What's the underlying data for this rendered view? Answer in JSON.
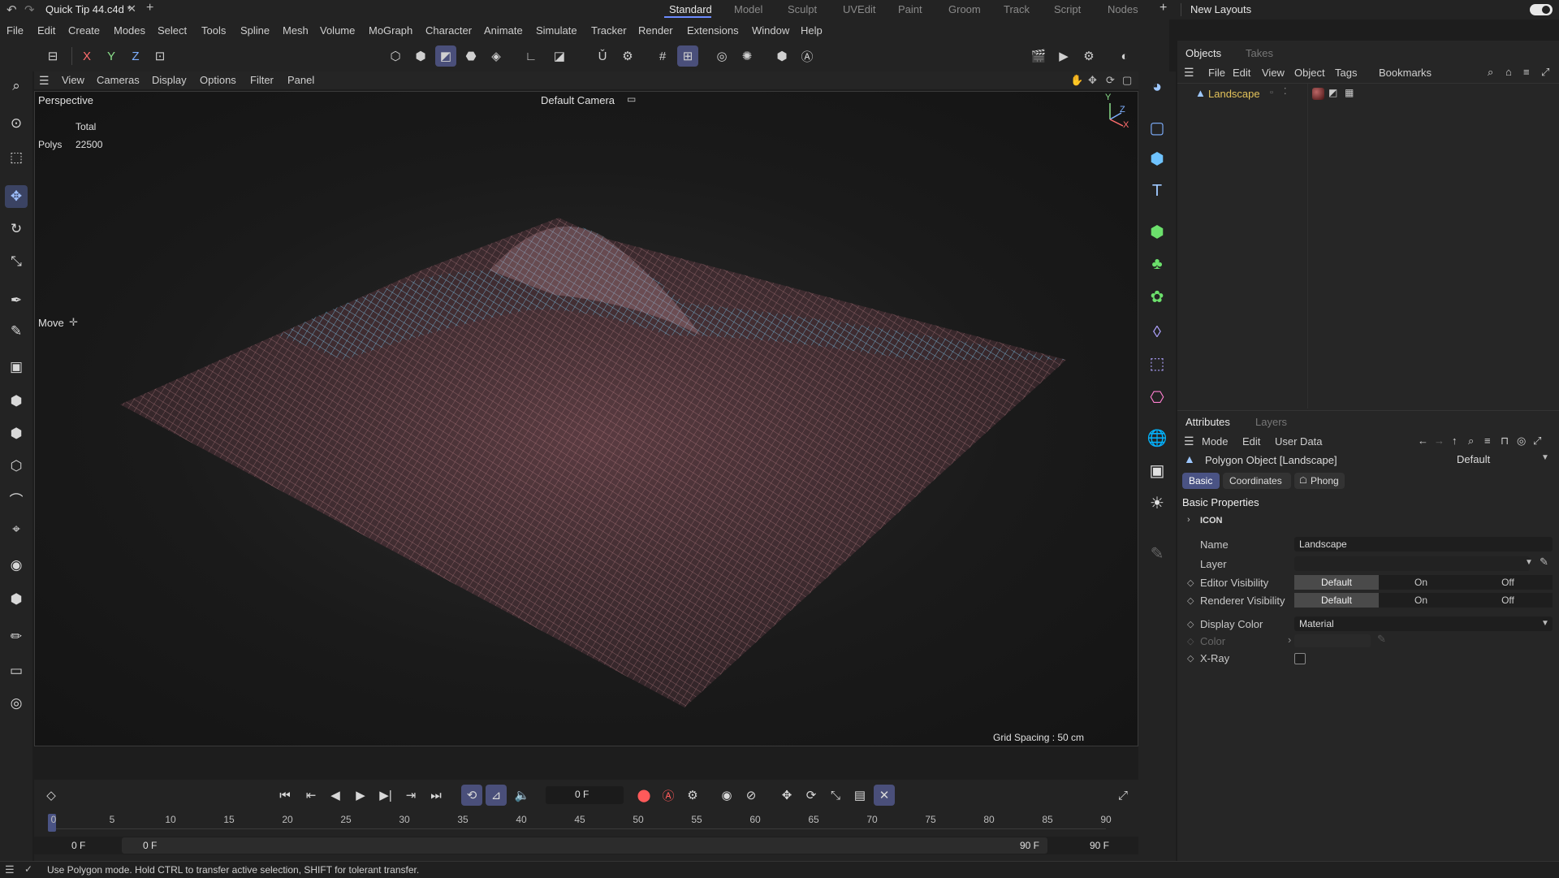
{
  "app": {
    "file_title": "Quick Tip 44.c4d *",
    "layouts": [
      "Standard",
      "Model",
      "Sculpt",
      "UVEdit",
      "Paint",
      "Groom",
      "Track",
      "Script",
      "Nodes"
    ],
    "active_layout": "Standard",
    "new_layouts_label": "New Layouts"
  },
  "menubar": [
    "File",
    "Edit",
    "Create",
    "Modes",
    "Select",
    "Tools",
    "Spline",
    "Mesh",
    "Volume",
    "MoGraph",
    "Character",
    "Animate",
    "Simulate",
    "Tracker",
    "Render",
    "Extensions",
    "Window",
    "Help"
  ],
  "toolbar": {
    "axis_x": "X",
    "axis_y": "Y",
    "axis_z": "Z"
  },
  "viewport": {
    "menu": [
      "View",
      "Cameras",
      "Display",
      "Options",
      "Filter",
      "Panel"
    ],
    "mode_label": "Perspective",
    "camera_label": "Default Camera",
    "stats_header": "Total",
    "stats_polys_label": "Polys",
    "stats_polys_value": "22500",
    "tool_label": "Move",
    "grid_spacing": "Grid Spacing : 50 cm",
    "axis_y": "Y",
    "axis_z": "Z",
    "axis_x": "X"
  },
  "objects_panel": {
    "tabs": [
      "Objects",
      "Takes"
    ],
    "menu": [
      "File",
      "Edit",
      "View",
      "Object",
      "Tags",
      "Bookmarks"
    ],
    "object_name": "Landscape"
  },
  "attributes_panel": {
    "tabs": [
      "Attributes",
      "Layers"
    ],
    "menu": [
      "Mode",
      "Edit",
      "User Data"
    ],
    "object_title": "Polygon Object [Landscape]",
    "preset": "Default",
    "subtabs": [
      "Basic",
      "Coordinates",
      "Phong"
    ],
    "section_title": "Basic Properties",
    "icon_group": "ICON",
    "name_label": "Name",
    "name_value": "Landscape",
    "layer_label": "Layer",
    "editor_vis_label": "Editor Visibility",
    "renderer_vis_label": "Renderer Visibility",
    "vis_options": [
      "Default",
      "On",
      "Off"
    ],
    "display_color_label": "Display Color",
    "display_color_value": "Material",
    "color_label": "Color",
    "xray_label": "X-Ray"
  },
  "timeline": {
    "current_frame": "0 F",
    "ticks": [
      "0",
      "5",
      "10",
      "15",
      "20",
      "25",
      "30",
      "35",
      "40",
      "45",
      "50",
      "55",
      "60",
      "65",
      "70",
      "75",
      "80",
      "85",
      "90"
    ],
    "range_start_a": "0 F",
    "range_start_b": "0 F",
    "range_end_a": "90 F",
    "range_end_b": "90 F"
  },
  "status_text": "Use Polygon mode. Hold CTRL to transfer active selection, SHIFT for tolerant transfer.",
  "colors": {
    "accent": "#6c8bff",
    "selected_tool": "#4a4f7a",
    "mesh_blue": "#4fb3dc",
    "mesh_pink": "#c98a8f",
    "object_name_color": "#e3c25a"
  }
}
